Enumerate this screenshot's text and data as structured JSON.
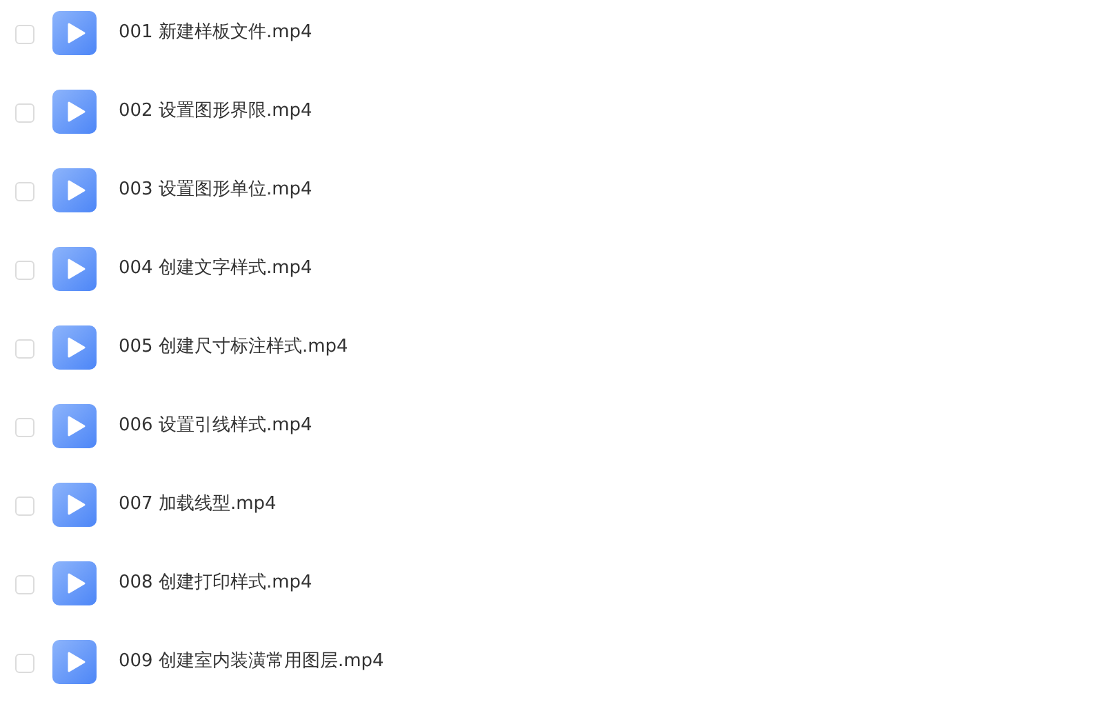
{
  "files": [
    {
      "name": "001 新建样板文件.mp4",
      "checked": false
    },
    {
      "name": "002 设置图形界限.mp4",
      "checked": false
    },
    {
      "name": "003 设置图形单位.mp4",
      "checked": false
    },
    {
      "name": "004 创建文字样式.mp4",
      "checked": false
    },
    {
      "name": "005 创建尺寸标注样式.mp4",
      "checked": false
    },
    {
      "name": "006 设置引线样式.mp4",
      "checked": false
    },
    {
      "name": "007 加载线型.mp4",
      "checked": false
    },
    {
      "name": "008 创建打印样式.mp4",
      "checked": false
    },
    {
      "name": "009 创建室内装潢常用图层.mp4",
      "checked": false
    }
  ]
}
